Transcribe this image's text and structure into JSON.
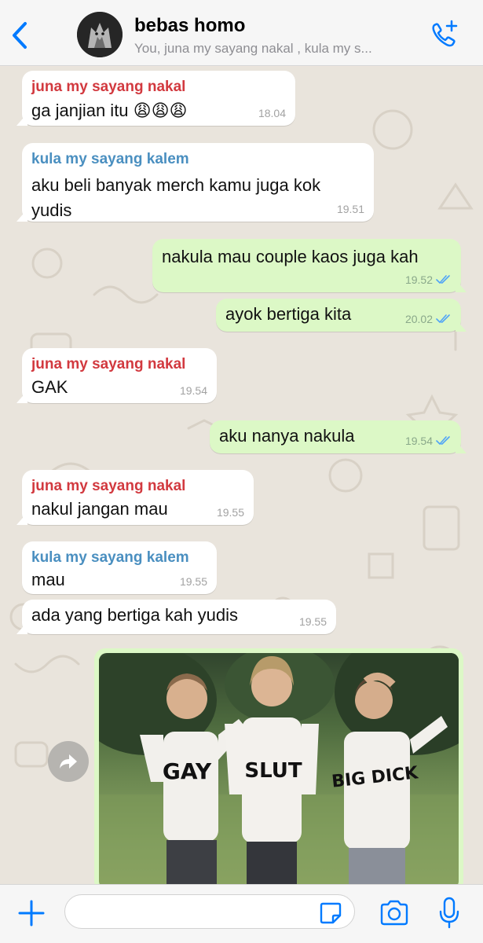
{
  "header": {
    "title": "bebas homo",
    "subtitle": "You, juna my sayang nakal , kula my s..."
  },
  "messages": [
    {
      "direction": "in",
      "sender": "juna my sayang nakal",
      "text": "ga janjian itu 😩😩😩",
      "time": "18.04"
    },
    {
      "direction": "in",
      "sender": "kula my sayang kalem",
      "text": "aku beli banyak merch kamu juga kok yudis",
      "time": "19.51"
    },
    {
      "direction": "out",
      "text": "nakula mau couple kaos juga kah",
      "time": "19.52",
      "status": "read"
    },
    {
      "direction": "out",
      "text": "ayok bertiga kita",
      "time": "20.02",
      "status": "read"
    },
    {
      "direction": "in",
      "sender": "juna my sayang nakal",
      "text": "GAK",
      "time": "19.54"
    },
    {
      "direction": "out",
      "text": "aku nanya nakula",
      "time": "19.54",
      "status": "read"
    },
    {
      "direction": "in",
      "sender": "juna my sayang nakal",
      "text": "nakul jangan mau",
      "time": "19.55"
    },
    {
      "direction": "in",
      "sender": "kula my sayang kalem",
      "text": "mau",
      "time": "19.55"
    },
    {
      "direction": "in",
      "text": "ada yang bertiga kah yudis",
      "time": "19.55"
    }
  ],
  "image_message": {
    "shirts": [
      "GAY",
      "SLUT",
      "BIG DICK"
    ]
  },
  "input": {
    "value": "",
    "placeholder": ""
  },
  "colors": {
    "accent": "#007aff",
    "sender_red": "#d2393f",
    "sender_blue": "#4a8fc0",
    "outgoing_bubble": "#dcf8c6",
    "read_ticks": "#4fa3f7"
  }
}
